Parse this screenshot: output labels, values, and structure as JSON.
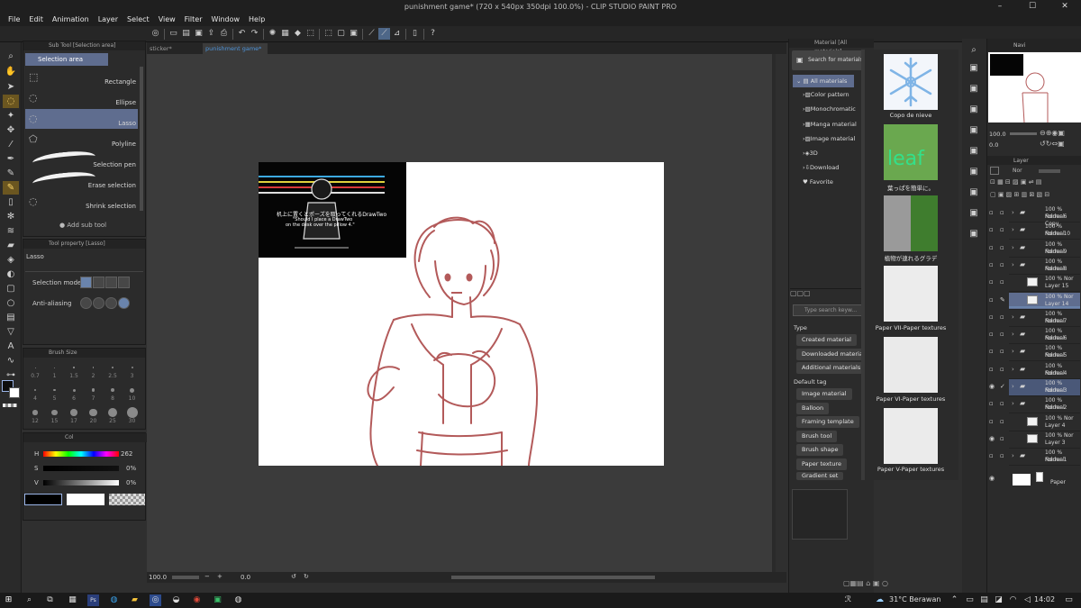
{
  "app": {
    "title": "punishment game* (720 x 540px 350dpi 100.0%) - CLIP STUDIO PAINT PRO"
  },
  "menu": [
    "File",
    "Edit",
    "Animation",
    "Layer",
    "Select",
    "View",
    "Filter",
    "Window",
    "Help"
  ],
  "tabs": [
    {
      "label": "sticker*"
    },
    {
      "label": "punishment game*"
    }
  ],
  "subtool": {
    "header": "Sub Tool [Selection area]",
    "group": "Selection area",
    "items": [
      "Rectangle",
      "Ellipse",
      "Lasso",
      "Polyline",
      "Selection pen",
      "Erase selection",
      "Shrink selection"
    ],
    "add_label": "Add sub tool"
  },
  "toolprop": {
    "header": "Tool property [Lasso]",
    "name": "Lasso",
    "selection_mode": "Selection mode",
    "anti_aliasing": "Anti-aliasing"
  },
  "brushsize": {
    "header": "Brush Size",
    "sizes": [
      "0.7",
      "1",
      "1.5",
      "2",
      "2.5",
      "3",
      "4",
      "5",
      "6",
      "7",
      "8",
      "10",
      "12",
      "15",
      "17",
      "20",
      "25",
      "30"
    ]
  },
  "color": {
    "tab": "Col",
    "h_label": "H",
    "h_value": "262",
    "s_label": "S",
    "s_value": "0%",
    "v_label": "V",
    "v_value": "0%"
  },
  "statusbar": {
    "zoom": "100.0",
    "rotation": "0.0"
  },
  "canvas": {
    "ref_line1": "机上に置くとポーズを取ってくれるDrawTwo",
    "ref_line2": "\"Should I place a DrawTwo",
    "ref_line3": "on the desk over the pillow 4.\""
  },
  "material": {
    "header": "Material [All materials]",
    "search_top": "Search for materials on ...",
    "tree": [
      "All materials",
      "Color pattern",
      "Monochromatic",
      "Manga material",
      "Image material",
      "3D",
      "Download",
      "Favorite"
    ],
    "search_placeholder": "Type search keyw...",
    "type_label": "Type",
    "type_tags": [
      "Created material",
      "Downloaded material",
      "Additional materials"
    ],
    "default_tag_label": "Default tag",
    "default_tags": [
      "Image material",
      "Balloon",
      "Framing template",
      "Brush tool",
      "Brush shape",
      "Paper texture",
      "Gradient set"
    ],
    "items": [
      "Copo de nieve",
      "葉っぱを簡単に。",
      "植物が連れるグラデ",
      "Paper VII-Paper textures",
      "Paper VI-Paper textures",
      "Paper V-Paper textures"
    ],
    "leaf_text": "leaf"
  },
  "navigator": {
    "tab": "Navi",
    "zoom": "100.0",
    "rot": "0.0"
  },
  "layers": {
    "tab": "Layer",
    "blend": "Nor",
    "rows": [
      {
        "pct": "100 % Normal",
        "name": "Folder 6 Copy",
        "type": "folder"
      },
      {
        "pct": "100 % Normal",
        "name": "Folder 10",
        "type": "folder"
      },
      {
        "pct": "100 % Normal",
        "name": "Folder 9",
        "type": "folder"
      },
      {
        "pct": "100 % Normal",
        "name": "Folder 8",
        "type": "folder"
      },
      {
        "pct": "100 % Nor",
        "name": "Layer 15",
        "type": "layer"
      },
      {
        "pct": "100 % Nor",
        "name": "Layer 14",
        "type": "layer"
      },
      {
        "pct": "100 % Normal",
        "name": "Folder 7",
        "type": "folder"
      },
      {
        "pct": "100 % Normal",
        "name": "Folder 6",
        "type": "folder"
      },
      {
        "pct": "100 % Normal",
        "name": "Folder 5",
        "type": "folder"
      },
      {
        "pct": "100 % Normal",
        "name": "Folder 4",
        "type": "folder"
      },
      {
        "pct": "100 % Normal",
        "name": "Folder 3",
        "type": "folder"
      },
      {
        "pct": "100 % Normal",
        "name": "Folder 2",
        "type": "folder"
      },
      {
        "pct": "100 % Nor",
        "name": "Layer 4",
        "type": "layer"
      },
      {
        "pct": "100 % Nor",
        "name": "Layer 3",
        "type": "layer"
      },
      {
        "pct": "100 % Normal",
        "name": "Folder 1",
        "type": "folder"
      }
    ],
    "paper": "Paper"
  },
  "taskbar": {
    "weather": "31°C Berawan",
    "time": "14:02"
  },
  "colors": {
    "accent": "#6a84ac",
    "selection": "#5f6d8f",
    "sketch": "#b35a5a",
    "tool_active": "#6b5620"
  }
}
